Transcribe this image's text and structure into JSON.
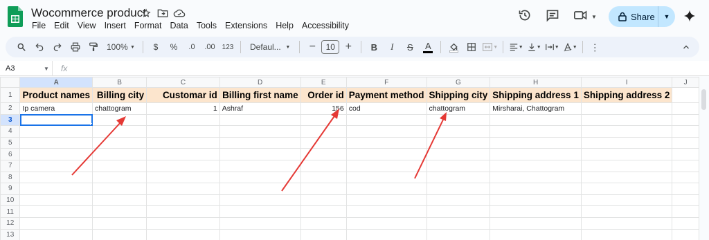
{
  "app": {
    "title": "Wocommerce product",
    "menu": [
      "File",
      "Edit",
      "View",
      "Insert",
      "Format",
      "Data",
      "Tools",
      "Extensions",
      "Help",
      "Accessibility"
    ],
    "share_label": "Share"
  },
  "toolbar": {
    "zoom": "100%",
    "currency": "$",
    "percent": "%",
    "dec_decrease": ".0",
    "dec_increase": ".00",
    "number_format": "123",
    "font": "Defaul...",
    "font_size": "10",
    "bold": "B",
    "italic": "I",
    "strike": "S",
    "text_color": "A"
  },
  "formula_bar": {
    "cell_ref": "A3",
    "fx": "fx",
    "value": ""
  },
  "sheet": {
    "columns": [
      "A",
      "B",
      "C",
      "D",
      "E",
      "F",
      "G",
      "H",
      "I",
      "J"
    ],
    "row_numbers": [
      "1",
      "2",
      "3",
      "4",
      "5",
      "6",
      "7",
      "8",
      "9",
      "10",
      "11",
      "12",
      "13"
    ],
    "header": [
      "Product names",
      "Billing city",
      "Customar id",
      "Billing first name",
      "Order id",
      "Payment method",
      "Shipping city",
      "Shipping address 1",
      "Shipping address 2",
      ""
    ],
    "row2": [
      "Ip camera",
      "chattogram",
      "1",
      "Ashraf",
      "156",
      "cod",
      "chattogram",
      "Mirsharai, Chattogram",
      "",
      ""
    ],
    "active_cell": "A3"
  },
  "colors": {
    "header_fill": "#fce5cd",
    "selection": "#1a73e8",
    "arrow": "#e53935",
    "share_bg": "#c2e7ff"
  }
}
